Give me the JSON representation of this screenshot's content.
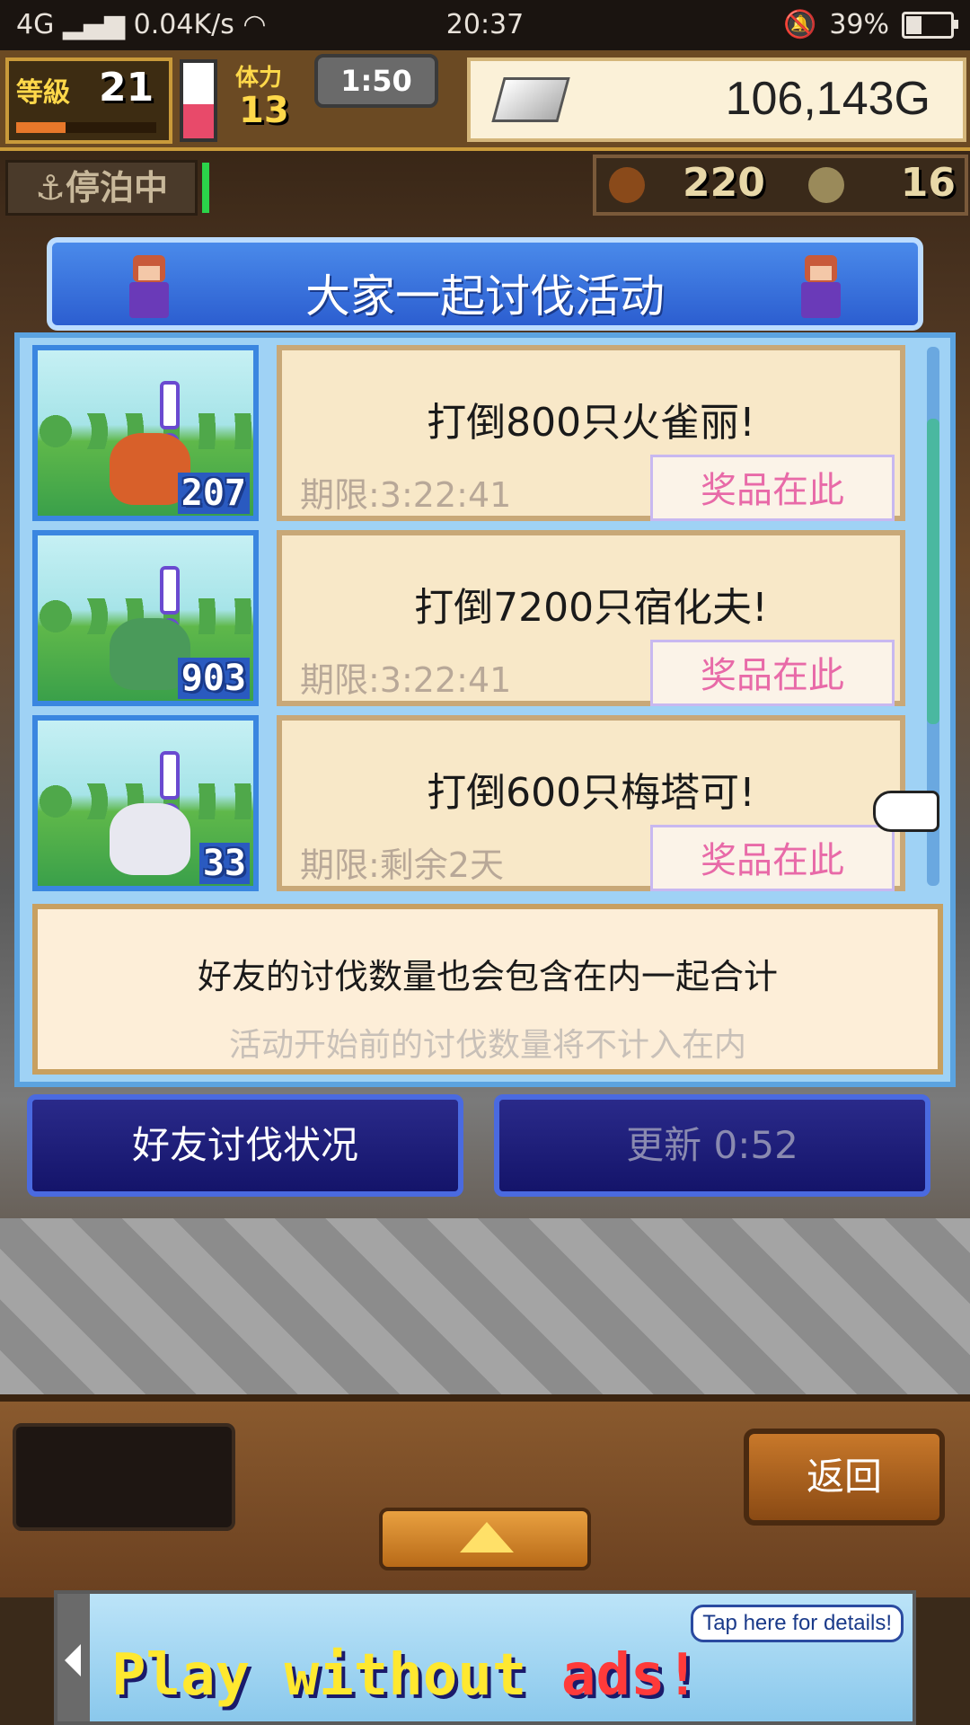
{
  "status_bar": {
    "network": "4G",
    "speed": "0.04K/s",
    "time": "20:37",
    "battery": "39%",
    "battery_level": 0.39
  },
  "hud": {
    "level_label": "等級",
    "level": "21",
    "xp_progress": 0.35,
    "stamina_label": "体力",
    "stamina": "13",
    "stamina_level": 0.45,
    "timer": "1:50",
    "gold": "106,143G"
  },
  "sub_hud": {
    "moored": "停泊中",
    "resource_1": "220",
    "resource_2": "16"
  },
  "dialog": {
    "title": "大家一起讨伐活动",
    "quests": [
      {
        "count": "207",
        "title": "打倒800只火雀丽!",
        "deadline": "期限:3:22:41",
        "prize": "奖品在此",
        "monster_color": "#d8602a"
      },
      {
        "count": "903",
        "title": "打倒7200只宿化夫!",
        "deadline": "期限:3:22:41",
        "prize": "奖品在此",
        "monster_color": "#4a9a5a"
      },
      {
        "count": "33",
        "title": "打倒600只梅塔可!",
        "deadline": "期限:剩余2天",
        "prize": "奖品在此",
        "monster_color": "#e8e8f0"
      }
    ],
    "info_line1": "好友的讨伐数量也会包含在内一起合计",
    "info_line2": "活动开始前的讨伐数量将不计入在内"
  },
  "buttons": {
    "friend_status": "好友讨伐状况",
    "refresh": "更新 0:52",
    "back": "返回"
  },
  "ad": {
    "text_main": "Play without ",
    "text_red": "ads!",
    "bubble": "Tap here for details!"
  },
  "colors": {
    "dialog_blue": "#2c5ed0",
    "card_bg": "#f8e8c8",
    "prize_pink": "#e86aa8"
  }
}
